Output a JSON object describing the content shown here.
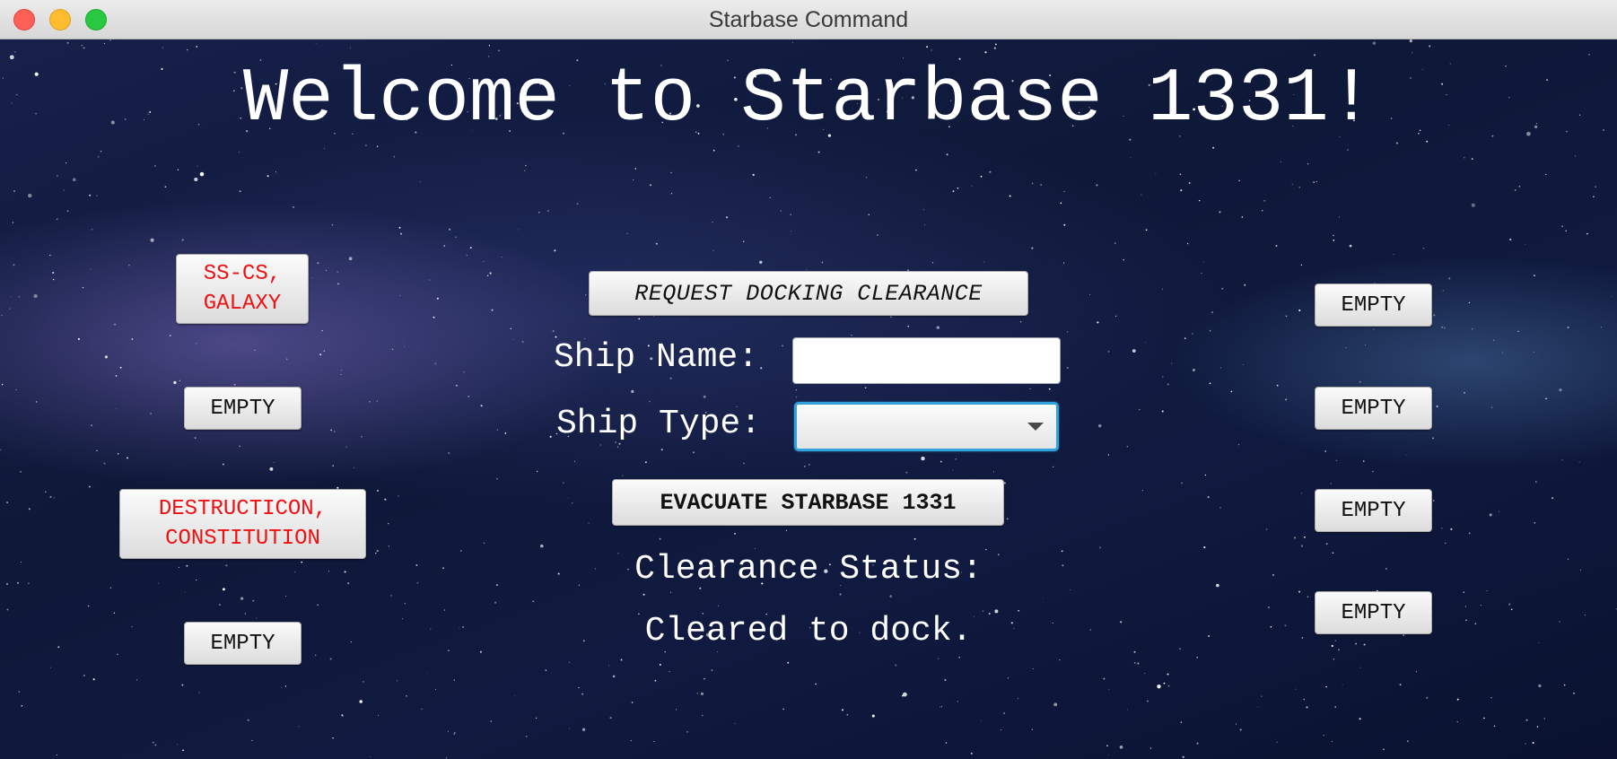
{
  "window": {
    "title": "Starbase Command"
  },
  "headline": "Welcome to Starbase 1331!",
  "left_bays": [
    {
      "label": "SS-CS,\nGALAXY",
      "occupied": true
    },
    {
      "label": "EMPTY",
      "occupied": false
    },
    {
      "label": "DESTRUCTICON,\nCONSTITUTION",
      "occupied": true
    },
    {
      "label": "EMPTY",
      "occupied": false
    }
  ],
  "right_bays": [
    {
      "label": "EMPTY",
      "occupied": false
    },
    {
      "label": "EMPTY",
      "occupied": false
    },
    {
      "label": "EMPTY",
      "occupied": false
    },
    {
      "label": "EMPTY",
      "occupied": false
    }
  ],
  "controls": {
    "request_label": "REQUEST DOCKING CLEARANCE",
    "ship_name_label": "Ship Name:",
    "ship_name_value": "",
    "ship_type_label": "Ship Type:",
    "ship_type_value": "",
    "evacuate_label": "EVACUATE STARBASE 1331"
  },
  "status": {
    "heading": "Clearance Status:",
    "message": "Cleared to dock."
  },
  "colors": {
    "occupied_text": "#ee1111",
    "empty_text": "#111111",
    "focus_ring": "#31a3dc"
  },
  "icons": {
    "dropdown": "chevron-down-icon"
  }
}
